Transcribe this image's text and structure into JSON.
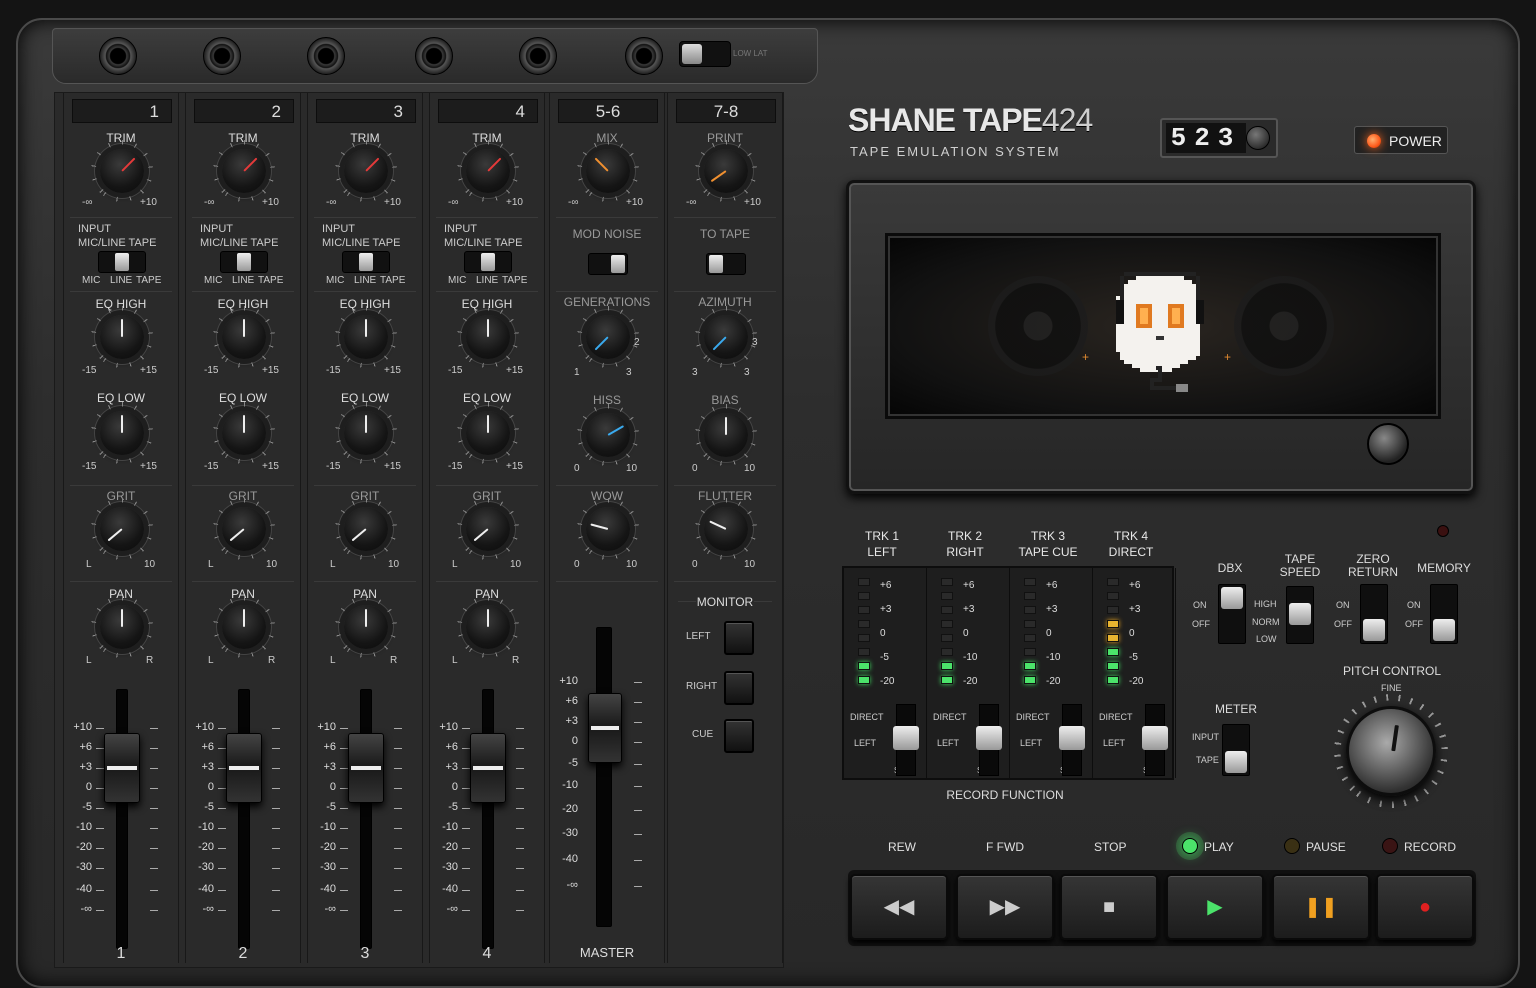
{
  "jackstrip": {
    "lowlat_label": "LOW LAT"
  },
  "channels": [
    {
      "num": "1",
      "trim": "TRIM",
      "input": "INPUT",
      "input_sub": "MIC/LINE TAPE",
      "sw_labels": [
        "MIC",
        "LINE",
        "TAPE"
      ],
      "eq_high": "EQ HIGH",
      "eq_low": "EQ LOW",
      "grit": "GRIT",
      "pan": "PAN",
      "footer": "1"
    },
    {
      "num": "2",
      "trim": "TRIM",
      "input": "INPUT",
      "input_sub": "MIC/LINE TAPE",
      "sw_labels": [
        "MIC",
        "LINE",
        "TAPE"
      ],
      "eq_high": "EQ HIGH",
      "eq_low": "EQ LOW",
      "grit": "GRIT",
      "pan": "PAN",
      "footer": "2"
    },
    {
      "num": "3",
      "trim": "TRIM",
      "input": "INPUT",
      "input_sub": "MIC/LINE TAPE",
      "sw_labels": [
        "MIC",
        "LINE",
        "TAPE"
      ],
      "eq_high": "EQ HIGH",
      "eq_low": "EQ LOW",
      "grit": "GRIT",
      "pan": "PAN",
      "footer": "3"
    },
    {
      "num": "4",
      "trim": "TRIM",
      "input": "INPUT",
      "input_sub": "MIC/LINE TAPE",
      "sw_labels": [
        "MIC",
        "LINE",
        "TAPE"
      ],
      "eq_high": "EQ HIGH",
      "eq_low": "EQ LOW",
      "grit": "GRIT",
      "pan": "PAN",
      "footer": "4"
    }
  ],
  "knob_ranges": {
    "trim": [
      "-∞",
      "+10"
    ],
    "eq": [
      "-15",
      "+15"
    ],
    "grit": [
      "L",
      "10"
    ],
    "pan": [
      "L",
      "R"
    ]
  },
  "fader_scale": [
    "+10",
    "+6",
    "+3",
    "0",
    "-5",
    "-10",
    "-20",
    "-30",
    "-40",
    "-∞"
  ],
  "strip56": {
    "num": "5-6",
    "mix": "MIX",
    "mix_range": [
      "-∞",
      "+10"
    ],
    "mod_noise": "MOD NOISE",
    "generations": "GENERATIONS",
    "gen_range": [
      "1",
      "2",
      "3"
    ],
    "hiss": "HISS",
    "hiss_range": [
      "0",
      "10"
    ],
    "wow": "WOW",
    "wow_range": [
      "0",
      "10"
    ],
    "footer": "MASTER",
    "master_scale": [
      "+10",
      "+6",
      "+3",
      "0",
      "-5",
      "-10",
      "-20",
      "-30",
      "-40",
      "-∞"
    ]
  },
  "strip78": {
    "num": "7-8",
    "print": "PRINT",
    "print_range": [
      "-∞",
      "+10"
    ],
    "to_tape": "TO TAPE",
    "azimuth": "AZIMUTH",
    "az_range": [
      "3",
      "3",
      "3"
    ],
    "bias": "BIAS",
    "bias_range": [
      "0",
      "10"
    ],
    "flutter": "FLUTTER",
    "flutter_range": [
      "0",
      "10"
    ],
    "monitor": "MONITOR",
    "monitor_buttons": [
      "LEFT",
      "RIGHT",
      "CUE"
    ]
  },
  "header": {
    "brand_a": "SHANE TAPE",
    "brand_b": "424",
    "subtitle": "TAPE EMULATION SYSTEM",
    "counter": "523",
    "power": "POWER"
  },
  "tracks": [
    {
      "line1": "TRK 1",
      "line2": "LEFT",
      "scale": [
        "+6",
        "+3",
        "0",
        "-5",
        "-20"
      ],
      "lit": 2,
      "amber": 0
    },
    {
      "line1": "TRK 2",
      "line2": "RIGHT",
      "scale": [
        "+6",
        "+3",
        "0",
        "-10",
        "-20"
      ],
      "lit": 2,
      "amber": 0
    },
    {
      "line1": "TRK 3",
      "line2": "TAPE CUE",
      "scale": [
        "+6",
        "+3",
        "0",
        "-10",
        "-20"
      ],
      "lit": 2,
      "amber": 0
    },
    {
      "line1": "TRK 4",
      "line2": "DIRECT",
      "scale": [
        "+6",
        "+3",
        "0",
        "-5",
        "-20"
      ],
      "lit": 5,
      "amber": 2
    }
  ],
  "record_switch_labels": {
    "direct": "DIRECT",
    "left": "LEFT",
    "safe": "SAFE"
  },
  "record_function": "RECORD FUNCTION",
  "dbx": {
    "label": "DBX",
    "on": "ON",
    "off": "OFF"
  },
  "tape_speed": {
    "label1": "TAPE",
    "label2": "SPEED",
    "high": "HIGH",
    "norm": "NORM",
    "low": "LOW"
  },
  "zero_return": {
    "label1": "ZERO",
    "label2": "RETURN",
    "on": "ON",
    "off": "OFF"
  },
  "memory": {
    "label": "MEMORY",
    "on": "ON",
    "off": "OFF"
  },
  "meter": {
    "label": "METER",
    "input": "INPUT",
    "tape": "TAPE"
  },
  "pitch": {
    "label": "PITCH CONTROL",
    "fine": "FINE"
  },
  "transport": [
    {
      "label": "REW",
      "glyph": "◀◀"
    },
    {
      "label": "F FWD",
      "glyph": "▶▶"
    },
    {
      "label": "STOP",
      "glyph": "■"
    },
    {
      "label": "PLAY",
      "glyph": "▶"
    },
    {
      "label": "PAUSE",
      "glyph": "❚❚"
    },
    {
      "label": "RECORD",
      "glyph": "●"
    }
  ],
  "colors": {
    "power_led": "#ff5a1a",
    "play_led": "#4be36a",
    "meter_green": "#4be36a",
    "meter_amber": "#e8b430",
    "trim_needle": "#e53a3a",
    "mix_needle": "#f09030",
    "tape_needle": "#3aaaee"
  }
}
